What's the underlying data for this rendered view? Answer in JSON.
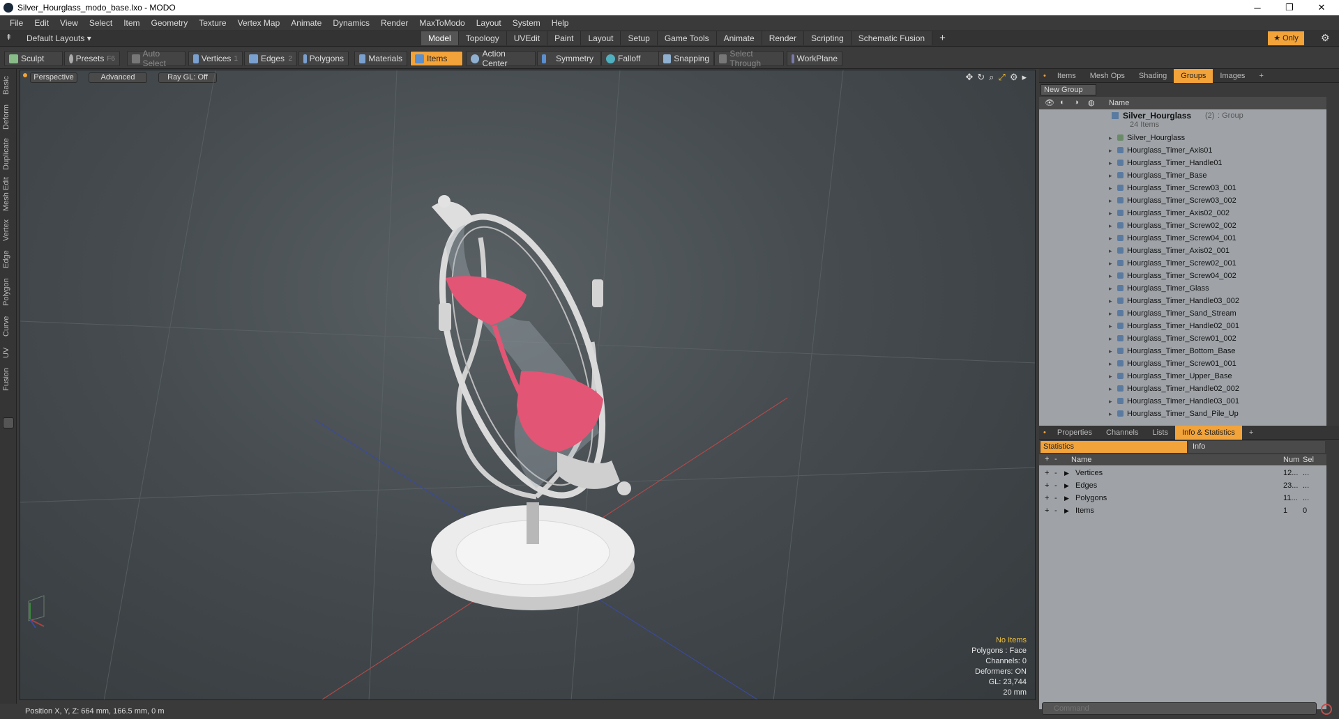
{
  "window": {
    "title": "Silver_Hourglass_modo_base.lxo - MODO",
    "minimize": "─",
    "maximize": "❐",
    "close": "✕"
  },
  "menu": [
    "File",
    "Edit",
    "View",
    "Select",
    "Item",
    "Geometry",
    "Texture",
    "Vertex Map",
    "Animate",
    "Dynamics",
    "Render",
    "MaxToModo",
    "Layout",
    "System",
    "Help"
  ],
  "layout": {
    "selector": "Default Layouts ▾",
    "tabs": [
      "Model",
      "Topology",
      "UVEdit",
      "Paint",
      "Layout",
      "Setup",
      "Game Tools",
      "Animate",
      "Render",
      "Scripting",
      "Schematic Fusion"
    ],
    "active": "Model",
    "add": "+",
    "only": "★ Only",
    "gear": "⚙"
  },
  "toolbar": {
    "sculpt": "Sculpt",
    "presets": "Presets",
    "presets_key": "F6",
    "auto_select": "Auto Select",
    "vertices": "Vertices",
    "vertices_count": "1",
    "edges": "Edges",
    "edges_count": "2",
    "polygons": "Polygons",
    "materials": "Materials",
    "items": "Items",
    "action_center": "Action Center",
    "symmetry": "Symmetry",
    "falloff": "Falloff",
    "snapping": "Snapping",
    "select_through": "Select Through",
    "workplane": "WorkPlane"
  },
  "left_tabs": [
    "Basic",
    "Deform",
    "Duplicate",
    "Mesh Edit",
    "Vertex",
    "Edge",
    "Polygon",
    "Curve",
    "UV",
    "Fusion"
  ],
  "viewport": {
    "view": "Perspective",
    "mode": "Advanced",
    "raygl": "Ray GL: Off",
    "overlay": {
      "no_items": "No Items",
      "polygons": "Polygons : Face",
      "channels": "Channels: 0",
      "deformers": "Deformers: ON",
      "gl": "GL: 23,744",
      "scale": "20 mm"
    }
  },
  "status": {
    "position": "Position X, Y, Z:  664 mm, 166.5 mm, 0 m"
  },
  "right_top": {
    "tabs": [
      "Items",
      "Mesh Ops",
      "Shading",
      "Groups",
      "Images",
      "+"
    ],
    "active": "Groups",
    "new_group": "New Group",
    "col_name": "Name",
    "group": {
      "name": "Silver_Hourglass",
      "count": "(2)",
      "type": ": Group",
      "sub": "24 Items"
    },
    "items": [
      "Silver_Hourglass",
      "Hourglass_Timer_Axis01",
      "Hourglass_Timer_Handle01",
      "Hourglass_Timer_Base",
      "Hourglass_Timer_Screw03_001",
      "Hourglass_Timer_Screw03_002",
      "Hourglass_Timer_Axis02_002",
      "Hourglass_Timer_Screw02_002",
      "Hourglass_Timer_Screw04_001",
      "Hourglass_Timer_Axis02_001",
      "Hourglass_Timer_Screw02_001",
      "Hourglass_Timer_Screw04_002",
      "Hourglass_Timer_Glass",
      "Hourglass_Timer_Handle03_002",
      "Hourglass_Timer_Sand_Stream",
      "Hourglass_Timer_Handle02_001",
      "Hourglass_Timer_Screw01_002",
      "Hourglass_Timer_Bottom_Base",
      "Hourglass_Timer_Screw01_001",
      "Hourglass_Timer_Upper_Base",
      "Hourglass_Timer_Handle02_002",
      "Hourglass_Timer_Handle03_001",
      "Hourglass_Timer_Sand_Pile_Up"
    ]
  },
  "right_bottom": {
    "tabs": [
      "Properties",
      "Channels",
      "Lists",
      "Info & Statistics",
      "+"
    ],
    "active": "Info & Statistics",
    "sub_tabs": [
      "Statistics",
      "Info"
    ],
    "cols": {
      "name": "Name",
      "num": "Num",
      "sel": "Sel"
    },
    "rows": [
      {
        "name": "Vertices",
        "num": "12...",
        "sel": "..."
      },
      {
        "name": "Edges",
        "num": "23...",
        "sel": "..."
      },
      {
        "name": "Polygons",
        "num": "11...",
        "sel": "..."
      },
      {
        "name": "Items",
        "num": "1",
        "sel": "0"
      }
    ]
  },
  "command": {
    "prompt": ">",
    "placeholder": "Command"
  }
}
